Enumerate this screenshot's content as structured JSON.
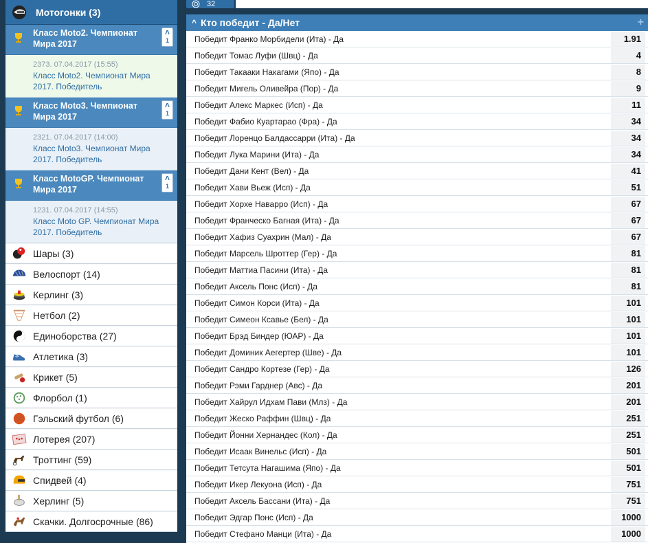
{
  "category": {
    "title": "Мотогонки (3)",
    "icon": "helmet-icon"
  },
  "tournaments": [
    {
      "title": "Класс Moto2. Чемпионат Мира 2017",
      "count": "1",
      "event_meta": "2373. 07.04.2017 (15:55)",
      "event_name": "Класс Moto2. Чемпионат Мира 2017. Победитель",
      "selected": true
    },
    {
      "title": "Класс Moto3. Чемпионат Мира 2017",
      "count": "1",
      "event_meta": "2321. 07.04.2017 (14:00)",
      "event_name": "Класс Moto3. Чемпионат Мира 2017. Победитель",
      "selected": false
    },
    {
      "title": "Класс MotoGP. Чемпионат Мира 2017",
      "count": "1",
      "event_meta": "1231. 07.04.2017 (14:55)",
      "event_name": "Класс Moto GP. Чемпионат Мира 2017. Победитель",
      "selected": false
    }
  ],
  "sports": [
    {
      "label": "Шары (3)",
      "icon": "balls-icon"
    },
    {
      "label": "Велоспорт (14)",
      "icon": "cycling-helmet-icon"
    },
    {
      "label": "Керлинг (3)",
      "icon": "curling-stone-icon"
    },
    {
      "label": "Нетбол (2)",
      "icon": "netball-hoop-icon"
    },
    {
      "label": "Единоборства (27)",
      "icon": "yin-yang-icon"
    },
    {
      "label": "Атлетика (3)",
      "icon": "running-shoe-icon"
    },
    {
      "label": "Крикет (5)",
      "icon": "cricket-icon"
    },
    {
      "label": "Флорбол (1)",
      "icon": "floorball-icon"
    },
    {
      "label": "Гэльский футбол (6)",
      "icon": "gaelic-ball-icon"
    },
    {
      "label": "Лотерея (207)",
      "icon": "lottery-ticket-icon"
    },
    {
      "label": "Троттинг (59)",
      "icon": "trotting-horse-icon"
    },
    {
      "label": "Спидвей (4)",
      "icon": "speedway-helmet-icon"
    },
    {
      "label": "Херлинг (5)",
      "icon": "hurling-icon"
    },
    {
      "label": "Скачки. Долгосрочные (86)",
      "icon": "racehorse-icon"
    }
  ],
  "top_button": {
    "label": "32",
    "icon": "target-icon"
  },
  "market": {
    "title": "Кто победит - Да/Нет",
    "rows": [
      {
        "name": "Победит Франко Морбидели (Ита) - Да",
        "odd": "1.91"
      },
      {
        "name": "Победит Томас Луфи (Швц) - Да",
        "odd": "4"
      },
      {
        "name": "Победит Такааки Накагами (Япо) - Да",
        "odd": "8"
      },
      {
        "name": "Победит Мигель Оливейра (Пор) - Да",
        "odd": "9"
      },
      {
        "name": "Победит Алекс Маркес (Исп) - Да",
        "odd": "11"
      },
      {
        "name": "Победит Фабио Куартарао (Фра) - Да",
        "odd": "34"
      },
      {
        "name": "Победит Лоренцо Балдассарри (Ита) - Да",
        "odd": "34"
      },
      {
        "name": "Победит Лука Марини (Ита) - Да",
        "odd": "34"
      },
      {
        "name": "Победит Дани Кент (Вел) - Да",
        "odd": "41"
      },
      {
        "name": "Победит Хави Вьеж (Исп) - Да",
        "odd": "51"
      },
      {
        "name": "Победит Хорхе Наварро (Исп) - Да",
        "odd": "67"
      },
      {
        "name": "Победит Франческо Багная (Ита) - Да",
        "odd": "67"
      },
      {
        "name": "Победит Хафиз Суахрин (Мал) - Да",
        "odd": "67"
      },
      {
        "name": "Победит Марсель Шроттер (Гер) - Да",
        "odd": "81"
      },
      {
        "name": "Победит Маттиа Пасини (Ита) - Да",
        "odd": "81"
      },
      {
        "name": "Победит Аксель Понс (Исп) - Да",
        "odd": "81"
      },
      {
        "name": "Победит Симон Корси (Ита) - Да",
        "odd": "101"
      },
      {
        "name": "Победит Симеон Ксавье (Бел) - Да",
        "odd": "101"
      },
      {
        "name": "Победит Брэд Биндер (ЮАР) - Да",
        "odd": "101"
      },
      {
        "name": "Победит Доминик Аегертер (Шве) - Да",
        "odd": "101"
      },
      {
        "name": "Победит Сандро Кортезе (Гер) - Да",
        "odd": "126"
      },
      {
        "name": "Победит Рэми Гарднер (Авс) - Да",
        "odd": "201"
      },
      {
        "name": "Победит Хайрул Идхам Пави (Млз) - Да",
        "odd": "201"
      },
      {
        "name": "Победит Жеско Раффин (Швц) - Да",
        "odd": "251"
      },
      {
        "name": "Победит Йонни Хернандес (Кол) - Да",
        "odd": "251"
      },
      {
        "name": "Победит Исаак Винельс (Исп) - Да",
        "odd": "501"
      },
      {
        "name": "Победит Тетсута Нагашима (Япо) - Да",
        "odd": "501"
      },
      {
        "name": "Победит Икер Лекуона (Исп) - Да",
        "odd": "751"
      },
      {
        "name": "Победит Аксель Бассани (Ита) - Да",
        "odd": "751"
      },
      {
        "name": "Победит Эдгар Понс (Исп) - Да",
        "odd": "1000"
      },
      {
        "name": "Победит Стефано Манци (Ита) - Да",
        "odd": "1000"
      }
    ]
  }
}
